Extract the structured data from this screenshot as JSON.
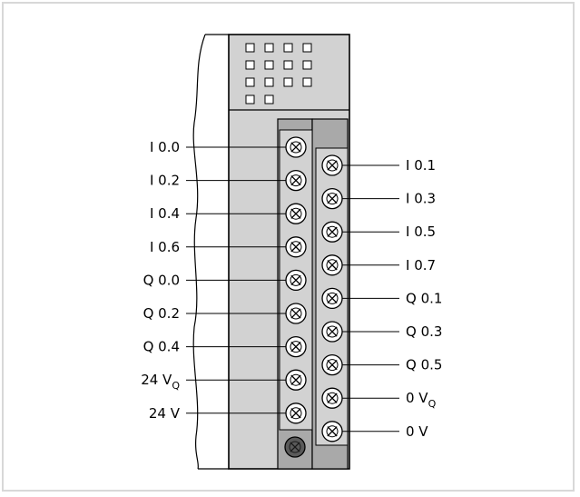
{
  "diagram": {
    "colors": {
      "module_face": "#d2d2d2",
      "terminal_strip": "#a9a9a9",
      "outline": "#000000",
      "led": "#ffffff",
      "background": "#ffffff"
    },
    "status_led_count": 14,
    "left_terminals": [
      {
        "label": "I 0.0"
      },
      {
        "label": "I 0.2"
      },
      {
        "label": "I 0.4"
      },
      {
        "label": "I 0.6"
      },
      {
        "label": "Q 0.0"
      },
      {
        "label": "Q 0.2"
      },
      {
        "label": "Q 0.4"
      },
      {
        "label": "24 V",
        "subscript": "Q"
      },
      {
        "label": "24 V"
      }
    ],
    "right_terminals": [
      {
        "label": "I 0.1"
      },
      {
        "label": "I 0.3"
      },
      {
        "label": "I 0.5"
      },
      {
        "label": "I 0.7"
      },
      {
        "label": "Q 0.1"
      },
      {
        "label": "Q 0.3"
      },
      {
        "label": "Q 0.5"
      },
      {
        "label": "0 V",
        "subscript": "Q"
      },
      {
        "label": "0 V"
      }
    ],
    "ground_screw_icon": "screw-terminal-icon"
  }
}
